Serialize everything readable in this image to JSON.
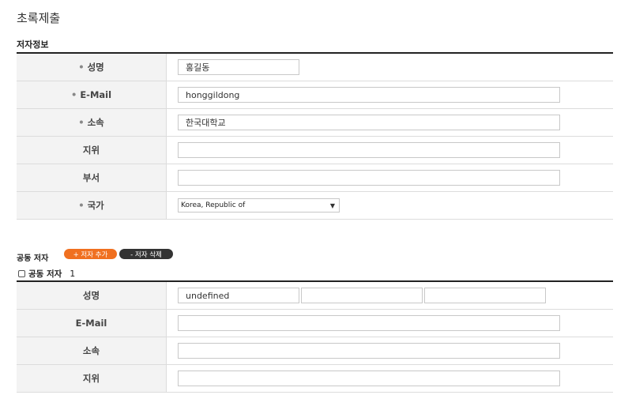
{
  "page": {
    "title": "초록제출"
  },
  "author_section": {
    "title": "저자정보",
    "rows": [
      {
        "label": "성명",
        "required": true,
        "value": "홍길동"
      },
      {
        "label": "E-Mail",
        "required": true,
        "value": "honggildong"
      },
      {
        "label": "소속",
        "required": true,
        "value": "한국대학교"
      },
      {
        "label": "지위",
        "required": false,
        "value": ""
      },
      {
        "label": "부서",
        "required": false,
        "value": ""
      },
      {
        "label": "국가",
        "required": true,
        "value": "Korea, Republic of"
      }
    ],
    "required_mark": "•"
  },
  "coauthor_section": {
    "title": "공동 저자",
    "add_button": "+ 저자 추가",
    "delete_button": "- 저자 삭제",
    "checkbox_label": "공동 저자",
    "index": "1",
    "rows": [
      {
        "label": "성명",
        "values": [
          "undefined",
          "",
          ""
        ]
      },
      {
        "label": "E-Mail",
        "value": ""
      },
      {
        "label": "소속",
        "value": ""
      },
      {
        "label": "지위",
        "value": ""
      }
    ]
  }
}
